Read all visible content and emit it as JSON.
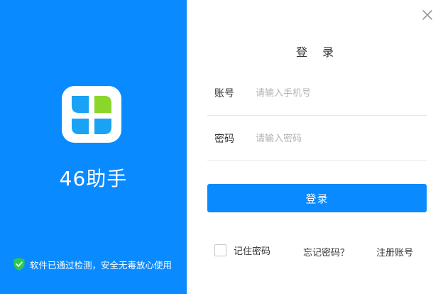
{
  "brand": {
    "app_name": "46助手",
    "security_text": "软件已通过检测，安全无毒放心使用"
  },
  "login": {
    "title": "登 录",
    "account_label": "账号",
    "account_placeholder": "请输入手机号",
    "password_label": "密码",
    "password_placeholder": "请输入密码",
    "submit_label": "登录",
    "remember_label": "记住密码",
    "remember_checked": false,
    "forgot_label": "忘记密码？",
    "register_label": "注册账号"
  },
  "colors": {
    "primary": "#0a8aff",
    "logo_leaf_blue": "#1aa3f5",
    "logo_leaf_green": "#8cd62a",
    "shield_green": "#2ec94a"
  },
  "icons": {
    "close": "close-icon",
    "logo": "app-logo-icon",
    "security": "shield-check-icon"
  }
}
